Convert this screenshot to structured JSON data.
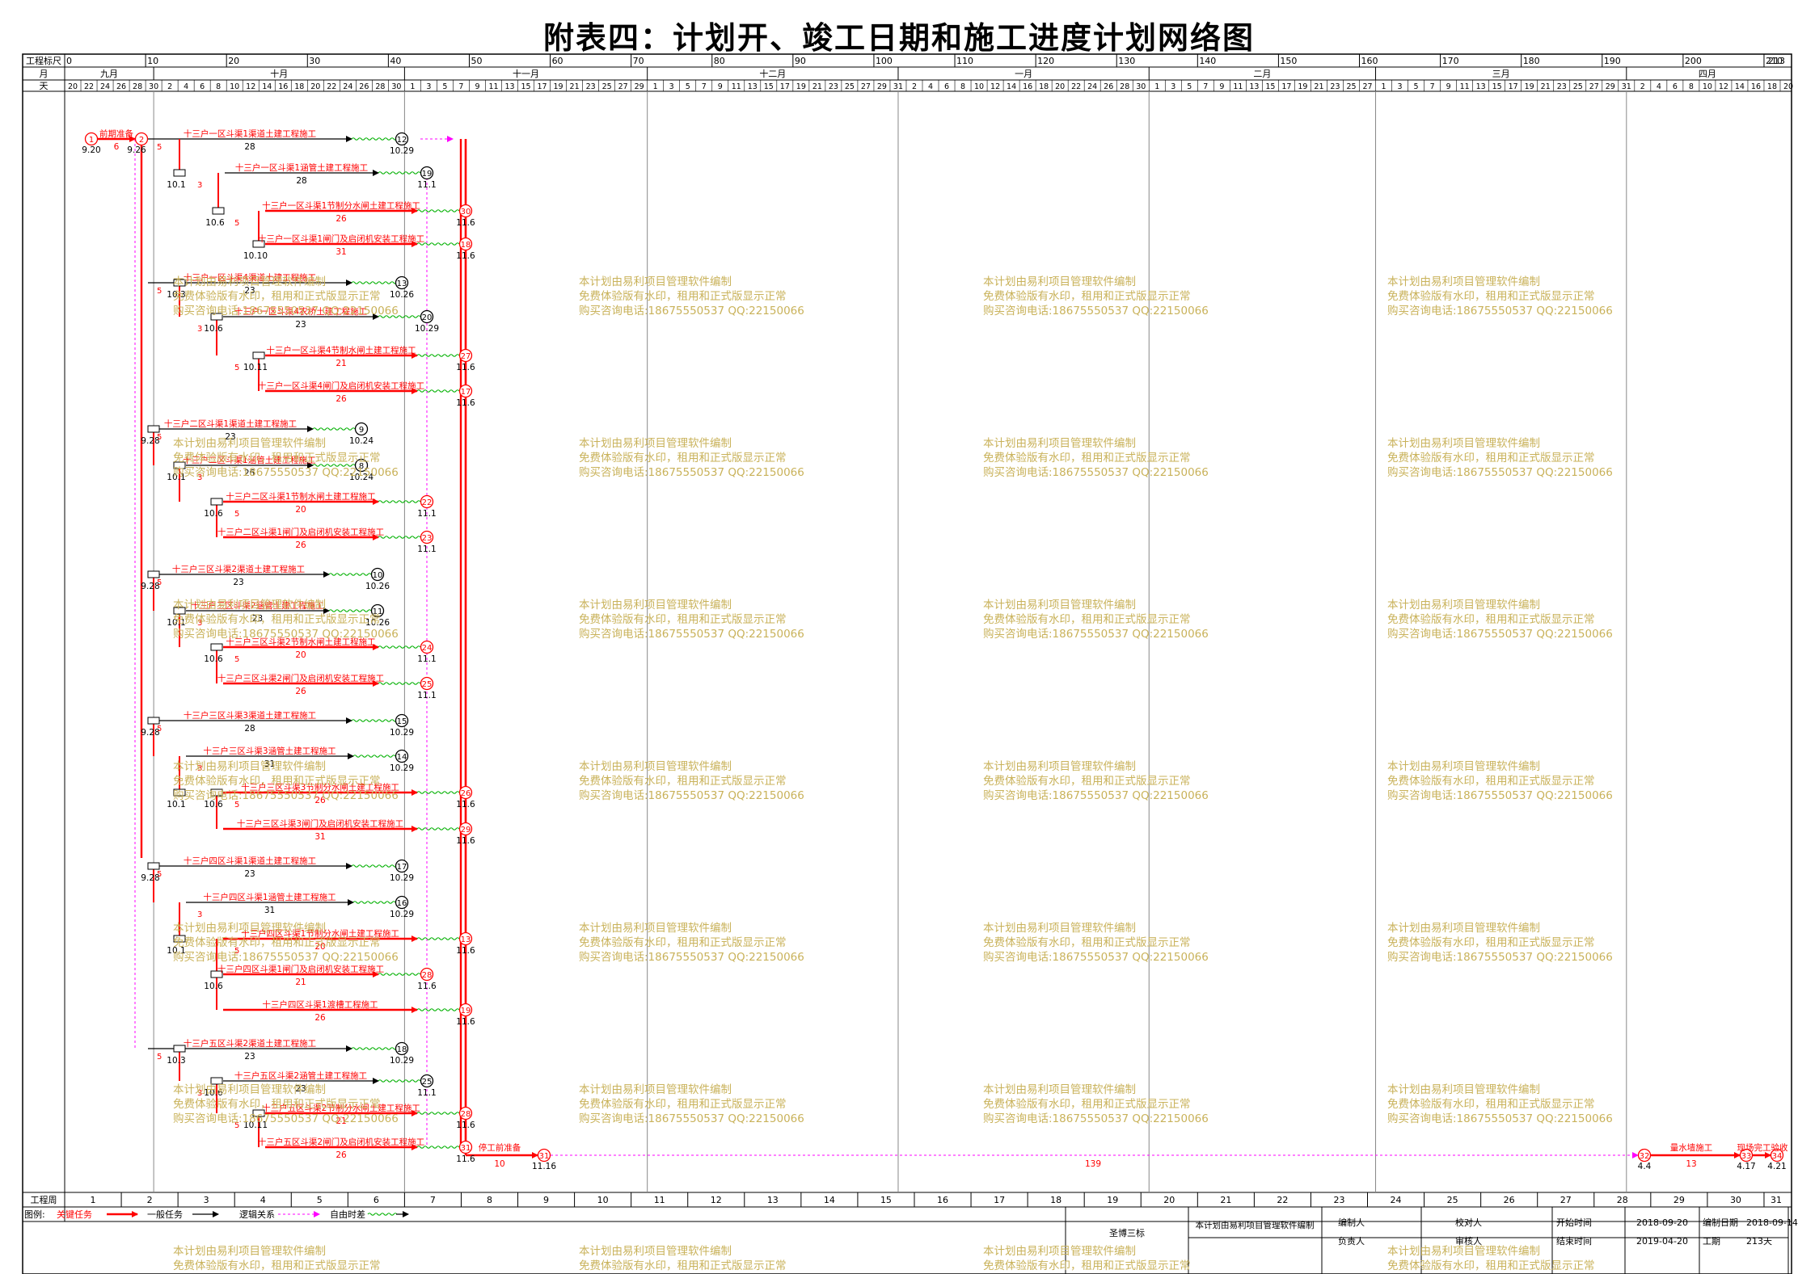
{
  "title": "附表四：计划开、竣工日期和施工进度计划网络图",
  "timeline": {
    "row_labels": {
      "ruler": "工程标尺",
      "month": "月",
      "day": "天",
      "week": "工程周"
    },
    "ruler_ticks": [
      "0",
      "10",
      "20",
      "30",
      "40",
      "50",
      "60",
      "70",
      "80",
      "90",
      "100",
      "110",
      "120",
      "130",
      "140",
      "150",
      "160",
      "170",
      "180",
      "190",
      "200",
      "210"
    ],
    "ruler_end_label": "213",
    "months": [
      "九月",
      "十月",
      "十一月",
      "十二月",
      "一月",
      "二月",
      "三月",
      "四月"
    ],
    "weeks": [
      "1",
      "2",
      "3",
      "4",
      "5",
      "6",
      "7",
      "8",
      "9",
      "10",
      "11",
      "12",
      "13",
      "14",
      "15",
      "16",
      "17",
      "18",
      "19",
      "20",
      "21",
      "22",
      "23",
      "24",
      "25",
      "26",
      "27",
      "28",
      "29",
      "30",
      "31"
    ]
  },
  "tasks": [
    {
      "label": "前期准备",
      "dur": "6"
    },
    {
      "label": "十三户一区斗渠1渠道土建工程施工",
      "dur": "28"
    },
    {
      "label": "十三户一区斗渠1涵管土建工程施工",
      "dur": "28"
    },
    {
      "label": "十三户一区斗渠1节制分水闸土建工程施工",
      "dur": "26"
    },
    {
      "label": "十三户一区斗渠1闸门及启闭机安装工程施工",
      "dur": "31"
    },
    {
      "label": "十三户一区斗渠4渠道土建工程施工",
      "dur": "23"
    },
    {
      "label": "十三户一区斗渠4农桥土建工程施工",
      "dur": "23"
    },
    {
      "label": "十三户一区斗渠4节制水闸土建工程施工",
      "dur": "21"
    },
    {
      "label": "十三户一区斗渠4闸门及启闭机安装工程施工",
      "dur": "26"
    },
    {
      "label": "十三户二区斗渠1渠道土建工程施工",
      "dur": "23"
    },
    {
      "label": "十三户二区斗渠1涵管土建工程施工",
      "dur": "26"
    },
    {
      "label": "十三户二区斗渠1节制水闸土建工程施工",
      "dur": "20"
    },
    {
      "label": "十三户二区斗渠1闸门及启闭机安装工程施工",
      "dur": "26"
    },
    {
      "label": "十三户三区斗渠2渠道土建工程施工",
      "dur": "23"
    },
    {
      "label": "十三户三区斗渠2涵管土建工程施工",
      "dur": "23"
    },
    {
      "label": "十三户三区斗渠2节制水闸土建工程施工",
      "dur": "20"
    },
    {
      "label": "十三户三区斗渠2闸门及启闭机安装工程施工",
      "dur": "26"
    },
    {
      "label": "十三户三区斗渠3渠道土建工程施工",
      "dur": "28"
    },
    {
      "label": "十三户三区斗渠3涵管土建工程施工",
      "dur": "31"
    },
    {
      "label": "十三户三区斗渠3节制分水闸土建工程施工",
      "dur": "26"
    },
    {
      "label": "十三户三区斗渠3闸门及启闭机安装工程施工",
      "dur": "31"
    },
    {
      "label": "十三户四区斗渠1渠道土建工程施工",
      "dur": "23"
    },
    {
      "label": "十三户四区斗渠1涵管土建工程施工",
      "dur": "31"
    },
    {
      "label": "十三户四区斗渠1节制分水闸土建工程施工",
      "dur": "20"
    },
    {
      "label": "十三户四区斗渠1闸门及启闭机安装工程施工",
      "dur": "21"
    },
    {
      "label": "十三户四区斗渠1渡槽工程施工",
      "dur": "26"
    },
    {
      "label": "十三户五区斗渠2渠道土建工程施工",
      "dur": "23"
    },
    {
      "label": "十三户五区斗渠2涵管土建工程施工",
      "dur": "23"
    },
    {
      "label": "十三户五区斗渠2节制分水闸土建工程施工",
      "dur": "21"
    },
    {
      "label": "十三户五区斗渠2闸门及启闭机安装工程施工",
      "dur": "26"
    },
    {
      "label": "停工前准备",
      "dur": "10"
    },
    {
      "label": "",
      "dur": "139"
    },
    {
      "label": "量水墙施工",
      "dur": "13"
    },
    {
      "label": "现场完工验收",
      "dur": "4"
    }
  ],
  "legend": {
    "title": "图例:",
    "critical": "关键任务",
    "normal": "一般任务",
    "logic": "逻辑关系",
    "free_float": "自由时差"
  },
  "footer": {
    "project": "圣博三标",
    "software": "本计划由易利项目管理软件编制",
    "compiler_label": "编制人",
    "checker_label": "校对人",
    "responsible_label": "负责人",
    "reviewer_label": "审核人",
    "start_label": "开始时间",
    "start_value": "2018-09-20",
    "end_label": "结束时间",
    "end_value": "2019-04-20",
    "made_label": "编制日期",
    "made_value": "2018-09-14",
    "duration_label": "工期",
    "duration_value": "213天"
  },
  "watermark": {
    "line1": "本计划由易利项目管理软件编制",
    "line2": "免费体验版有水印，租用和正式版显示正常",
    "line3": "购买咨询电话:18675550537 QQ:22150066"
  },
  "colors": {
    "critical": "#ff0000",
    "normal": "#000000",
    "float": "#ff00ff",
    "watermark": "#c9b25a",
    "green": "#00b000"
  }
}
